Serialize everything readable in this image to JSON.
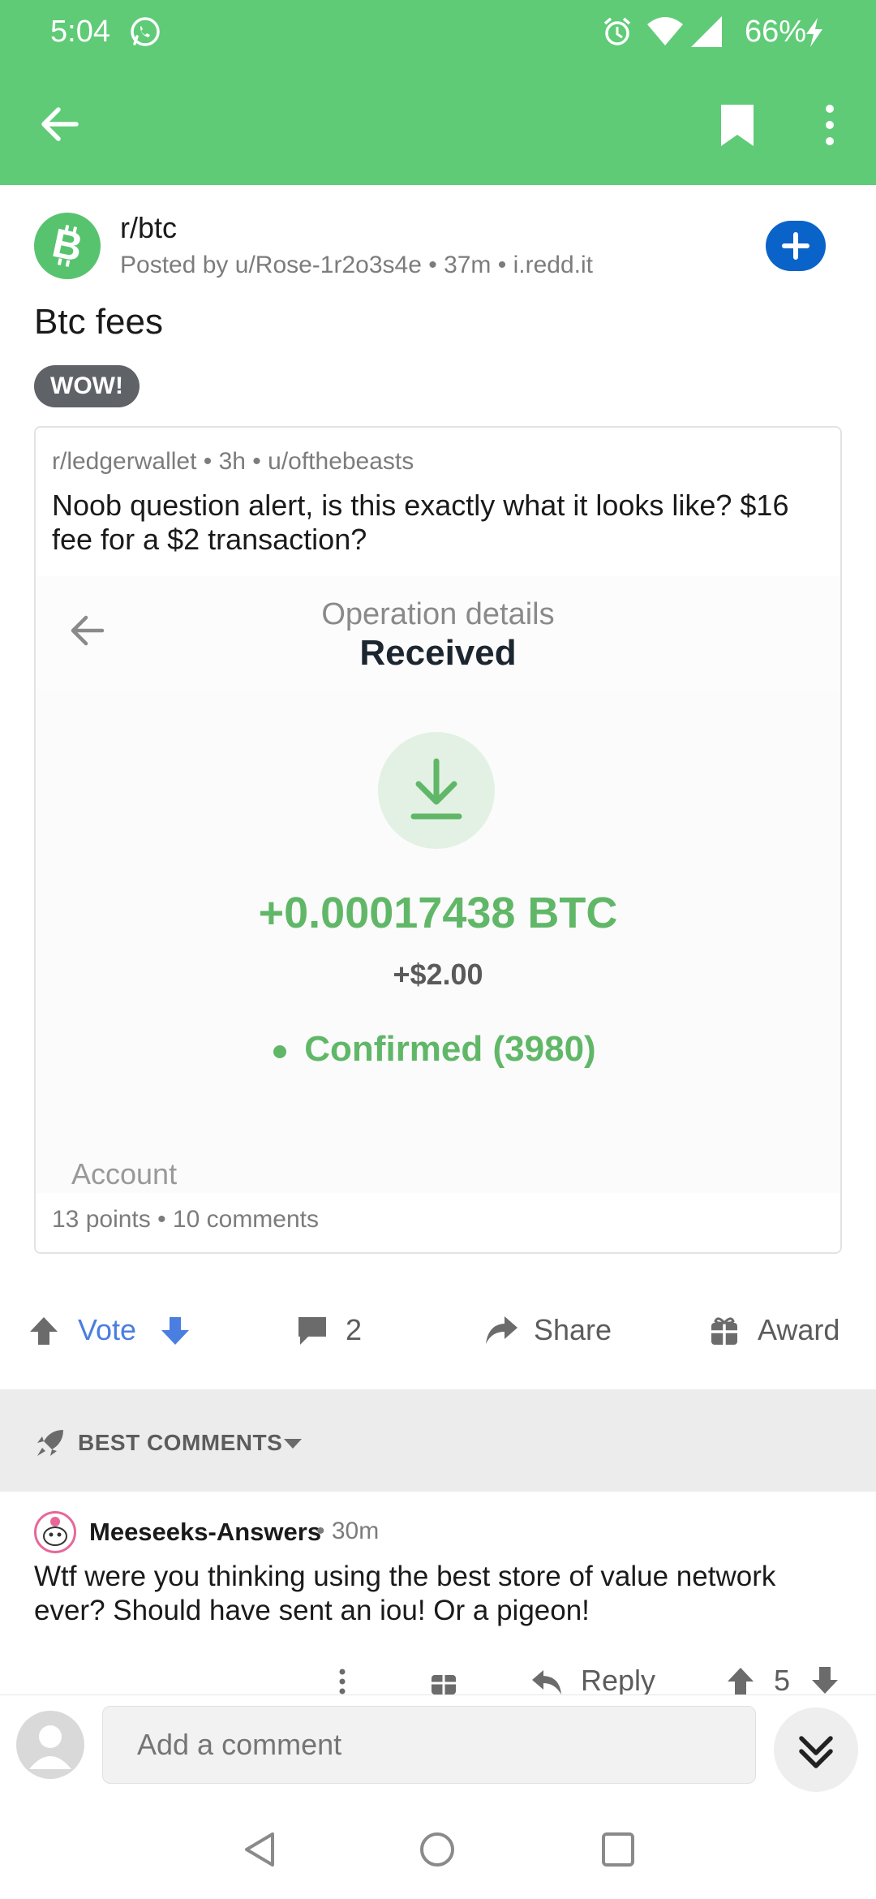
{
  "status_bar": {
    "time": "5:04",
    "battery": "66%",
    "icons": [
      "whatsapp-icon",
      "alarm-icon",
      "wifi-icon",
      "signal-icon",
      "charging-icon"
    ]
  },
  "app_bar": {
    "icons": [
      "back-arrow-icon",
      "bookmark-icon",
      "more-vert-icon"
    ],
    "color": "#5fcb77"
  },
  "post": {
    "subreddit": "r/btc",
    "meta": "Posted by u/Rose-1r2o3s4e • 37m • i.redd.it",
    "title": "Btc fees",
    "flair": "WOW!",
    "crosspost": {
      "meta": "r/ledgerwallet • 3h • u/ofthebeasts",
      "text": "Noob question alert, is this exactly what it looks like? $16 fee for a $2 transaction?",
      "screenshot": {
        "header_label": "Operation details",
        "status": "Received",
        "amount": "+0.00017438 BTC",
        "fiat": "+$2.00",
        "confirmed": "Confirmed (3980)",
        "account_label": "Account",
        "accent_color": "#61b768"
      },
      "footer": "13 points • 10 comments"
    },
    "actions": {
      "vote": "Vote",
      "comments": "2",
      "share": "Share",
      "award": "Award"
    }
  },
  "comments_section": {
    "sort_label": "BEST COMMENTS",
    "comment": {
      "author": "Meeseeks-Answers",
      "time": "• 30m",
      "body": "Wtf were you thinking using the best store of value network ever? Should have sent an iou! Or a pigeon!",
      "reply": "Reply",
      "score": "5"
    }
  },
  "composer": {
    "placeholder": "Add a comment"
  },
  "nav_bar": {
    "icons": [
      "nav-back-icon",
      "nav-home-icon",
      "nav-recents-icon"
    ]
  }
}
